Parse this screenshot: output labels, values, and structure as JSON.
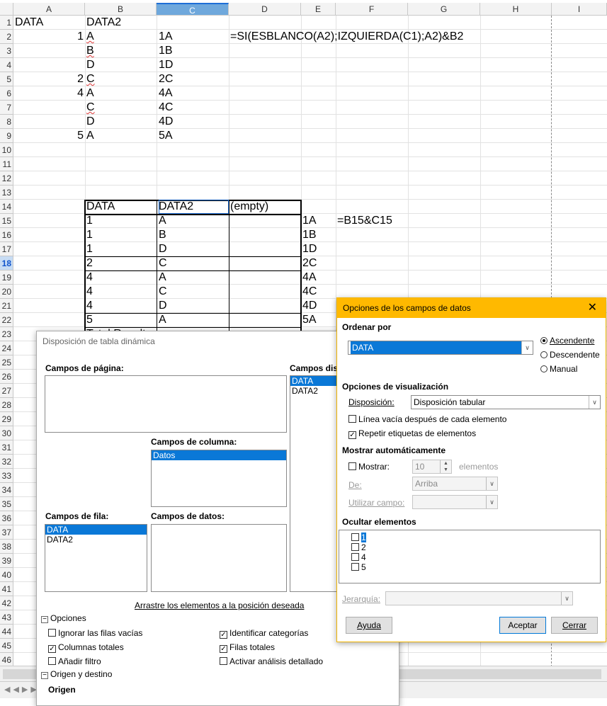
{
  "columns": [
    "A",
    "B",
    "C",
    "D",
    "E",
    "F",
    "G",
    "H",
    "I"
  ],
  "rows": [
    "1",
    "2",
    "3",
    "4",
    "5",
    "6",
    "7",
    "8",
    "9",
    "10",
    "11",
    "12",
    "13",
    "14",
    "15",
    "16",
    "17",
    "18",
    "19",
    "20",
    "21",
    "22",
    "23",
    "24",
    "25",
    "26",
    "27",
    "28",
    "29",
    "30",
    "31",
    "32",
    "33",
    "34",
    "35",
    "36",
    "37",
    "38",
    "39",
    "40",
    "41",
    "42",
    "43",
    "44",
    "45",
    "46"
  ],
  "cells": {
    "a1": "DATA",
    "b1": "DATA2",
    "a2": "1",
    "b2": "A",
    "c2": "1A",
    "d2": "=SI(ESBLANCO(A2);IZQUIERDA(C1);A2)&B2",
    "b3": "B",
    "c3": "1B",
    "b4": "D",
    "c4": "1D",
    "a5": "2",
    "b5": "C",
    "c5": "2C",
    "a6": "4",
    "b6": "A",
    "c6": "4A",
    "b7": "C",
    "c7": "4C",
    "b8": "D",
    "c8": "4D",
    "a9": "5",
    "b9": "A",
    "c9": "5A",
    "b14": "DATA",
    "c14": "DATA2",
    "d14": "(empty)",
    "b15": "1",
    "c15": "A",
    "e15": "1A",
    "f15": "=B15&C15",
    "b16": "1",
    "c16": "B",
    "e16": "1B",
    "b17": "1",
    "c17": "D",
    "e17": "1D",
    "b18": "2",
    "c18": "C",
    "e18": "2C",
    "b19": "4",
    "c19": "A",
    "e19": "4A",
    "b20": "4",
    "c20": "C",
    "e20": "4C",
    "b21": "4",
    "c21": "D",
    "e21": "4D",
    "b22": "5",
    "c22": "A",
    "e22": "5A",
    "b23": "Total Result"
  },
  "pivot_dialog": {
    "title": "Disposición de tabla dinámica",
    "page_fields_label": "Campos de página:",
    "available_fields_label": "Campos dis",
    "available_fields": [
      "DATA",
      "DATA2"
    ],
    "column_fields_label": "Campos de columna:",
    "column_fields": [
      "Datos"
    ],
    "row_fields_label": "Campos de fila:",
    "row_fields": [
      "DATA",
      "DATA2"
    ],
    "data_fields_label": "Campos de datos:",
    "drag_hint": "Arrastre los elementos a la posición deseada",
    "options_label": "Opciones",
    "opt_ignore_empty": "Ignorar las filas vacías",
    "opt_identify_categories": "Identificar categorías",
    "opt_total_columns": "Columnas totales",
    "opt_total_rows": "Filas totales",
    "opt_add_filter": "Añadir filtro",
    "opt_drilldown": "Activar análisis detallado",
    "source_dest_label": "Origen y destino",
    "source_label": "Origen"
  },
  "field_dialog": {
    "title": "Opciones de los campos de datos",
    "sort_by_label": "Ordenar por",
    "sort_field": "DATA",
    "asc": "Ascendente",
    "desc": "Descendente",
    "manual": "Manual",
    "display_options_label": "Opciones de visualización",
    "layout_label": "Disposición:",
    "layout_value": "Disposición tabular",
    "empty_line": "Línea vacía después de cada elemento",
    "repeat_labels": "Repetir etiquetas de elementos",
    "auto_show_label": "Mostrar automáticamente",
    "show_label": "Mostrar:",
    "show_count": "10",
    "elements_label": "elementos",
    "from_label": "De:",
    "from_value": "Arriba",
    "use_field_label": "Utilizar campo:",
    "hide_items_label": "Ocultar elementos",
    "hide_items": [
      "1",
      "2",
      "4",
      "5"
    ],
    "hierarchy_label": "Jerarquía:",
    "help_button": "Ayuda",
    "ok_button": "Aceptar",
    "close_button": "Cerrar"
  }
}
